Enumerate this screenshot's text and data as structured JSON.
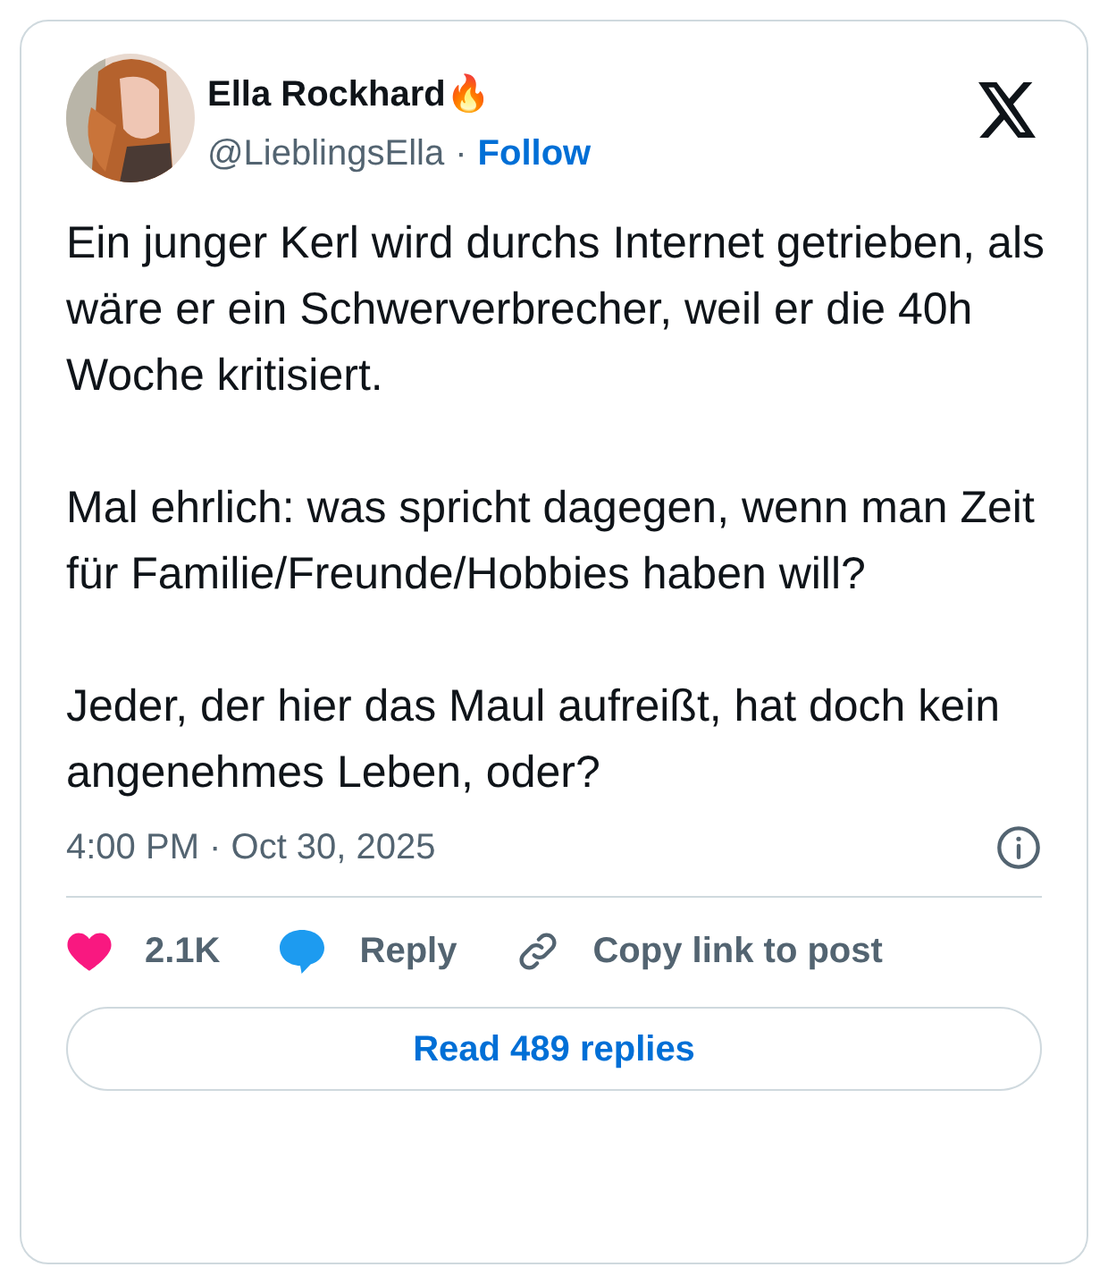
{
  "author": {
    "name": "Ella Rockhard🔥",
    "handle": "@LieblingsElla",
    "separator": "·",
    "follow": "Follow"
  },
  "paragraphs": [
    "Ein junger Kerl wird durchs Internet getrieben, als wäre er ein Schwerverbrecher, weil er die 40h Woche kritisiert.",
    "Mal ehrlich: was spricht dagegen, wenn man Zeit für Familie/Freunde/Hobbies haben will?",
    "Jeder, der hier das Maul aufreißt, hat doch kein angenehmes Leben, oder?"
  ],
  "timestamp": "4:00 PM · Oct 30, 2025",
  "actions": [
    {
      "kind": "like",
      "label": "2.1K"
    },
    {
      "kind": "reply",
      "label": "Reply"
    },
    {
      "kind": "copy",
      "label": "Copy link to post"
    }
  ],
  "read_button": "Read 489 replies"
}
